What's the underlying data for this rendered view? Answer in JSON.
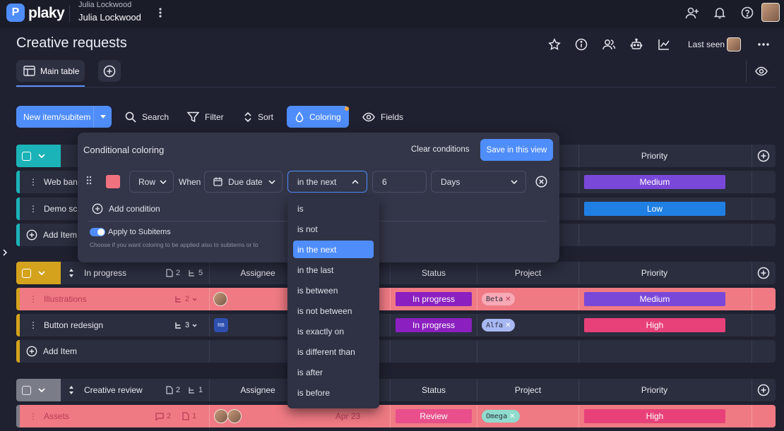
{
  "app": {
    "logo_text": "plaky",
    "workspace_label": "Julia Lockwood",
    "workspace_name": "Julia Lockwood"
  },
  "board": {
    "title": "Creative requests",
    "last_seen_label": "Last seen",
    "tabs": [
      {
        "label": "Main table"
      }
    ]
  },
  "toolbar": {
    "new_item_label": "New item/subitem",
    "search_label": "Search",
    "filter_label": "Filter",
    "sort_label": "Sort",
    "coloring_label": "Coloring",
    "fields_label": "Fields"
  },
  "coloring_popup": {
    "title": "Conditional coloring",
    "clear_label": "Clear conditions",
    "save_label": "Save in this view",
    "target_value": "Row",
    "when_label": "When",
    "field_value": "Due date",
    "operator_value": "in the next",
    "number_value": "6",
    "unit_value": "Days",
    "add_condition_label": "Add condition",
    "apply_subitems_label": "Apply to Subitems",
    "apply_subitems_hint": "Choose if you want coloring to be applied also to subitems or to",
    "swatch_color": "#f0727f",
    "operators": [
      "is",
      "is not",
      "in the next",
      "in the last",
      "is between",
      "is not between",
      "is exactly on",
      "is different than",
      "is after",
      "is before"
    ],
    "selected_operator_index": 2
  },
  "columns": {
    "assignee": "Assignee",
    "status": "Status",
    "project": "Project",
    "priority": "Priority"
  },
  "groups": [
    {
      "name": "",
      "color": "#1bb3b8",
      "items": [
        {
          "name": "Web bann",
          "priority": "Medium",
          "priority_color": "#7a48d9"
        },
        {
          "name": "Demo scr",
          "priority": "Low",
          "priority_color": "#1f7fe3"
        }
      ],
      "add_item_label": "Add Item"
    },
    {
      "name": "In progress",
      "color": "#d4a21c",
      "files": "2",
      "subitems": "5",
      "items": [
        {
          "name": "Illustrations",
          "subitems": "2",
          "status": "In progress",
          "status_color": "#8b1fbf",
          "project": "Beta",
          "project_color": "#f7a9b6",
          "priority": "Medium",
          "priority_color": "#7a48d9",
          "row_color": "#ef7a83"
        },
        {
          "name": "Button redesign",
          "subitems": "3",
          "assignee_initials": "RB",
          "status": "In progress",
          "status_color": "#8b1fbf",
          "project": "Alfa",
          "project_color": "#a8b8f2",
          "priority": "High",
          "priority_color": "#e8417a"
        }
      ],
      "add_item_label": "Add Item"
    },
    {
      "name": "Creative review",
      "color": "#7a7c88",
      "files": "2",
      "subitems": "1",
      "items": [
        {
          "name": "Assets",
          "comments": "2",
          "files": "1",
          "date": "Apr 23",
          "status": "Review",
          "status_color": "#e84f8b",
          "project": "Omega",
          "project_color": "#8fdccd",
          "priority": "High",
          "priority_color": "#e8417a",
          "row_color": "#ef7a83"
        }
      ]
    }
  ],
  "colors": {
    "accent": "#4f8dfb",
    "background": "#1f2130",
    "popup": "#333649"
  }
}
